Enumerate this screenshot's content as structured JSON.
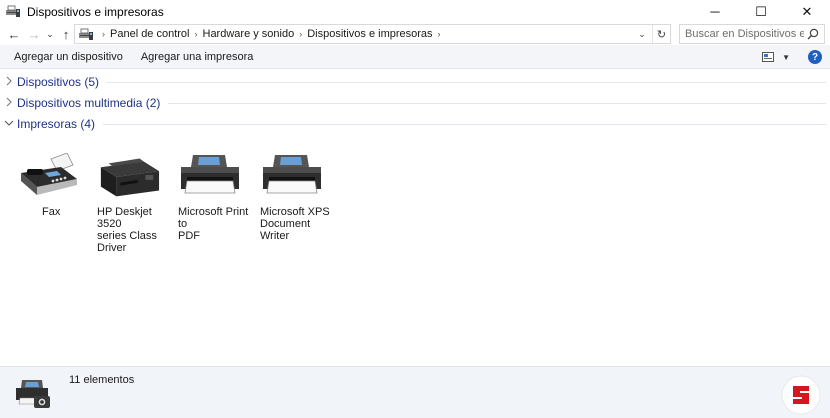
{
  "window": {
    "title": "Dispositivos e impresoras",
    "minimize_glyph": "─",
    "maximize_glyph": "☐",
    "close_glyph": "✕"
  },
  "nav": {
    "back_glyph": "←",
    "forward_glyph": "→",
    "recent_glyph": "⌄",
    "up_glyph": "↑"
  },
  "address": {
    "breadcrumbs": [
      "Panel de control",
      "Hardware y sonido",
      "Dispositivos e impresoras"
    ],
    "separator": "›",
    "dropdown_glyph": "⌄",
    "refresh_glyph": "↻"
  },
  "search": {
    "placeholder": "Buscar en Dispositivos e impr..."
  },
  "commands": {
    "add_device": "Agregar un dispositivo",
    "add_printer": "Agregar una impresora",
    "view_caret": "▼",
    "help": "?"
  },
  "groups": [
    {
      "label": "Dispositivos (5)",
      "expanded": false
    },
    {
      "label": "Dispositivos multimedia (2)",
      "expanded": false
    },
    {
      "label": "Impresoras (4)",
      "expanded": true
    }
  ],
  "printers": [
    {
      "line1": "Fax",
      "line2": "",
      "icon": "fax-icon"
    },
    {
      "line1": "HP Deskjet 3520",
      "line2": "series Class Driver",
      "icon": "inkjet-printer-icon"
    },
    {
      "line1": "Microsoft Print to",
      "line2": "PDF",
      "icon": "printer-icon"
    },
    {
      "line1": "Microsoft XPS",
      "line2": "Document Writer",
      "icon": "printer-icon"
    }
  ],
  "status": {
    "count_text": "11 elementos"
  },
  "colors": {
    "group_header": "#1e3287",
    "command_bar": "#f3f5f9",
    "status_bar": "#f1f4f9",
    "help_button": "#1f5fbf",
    "watermark": "#d5161d"
  }
}
